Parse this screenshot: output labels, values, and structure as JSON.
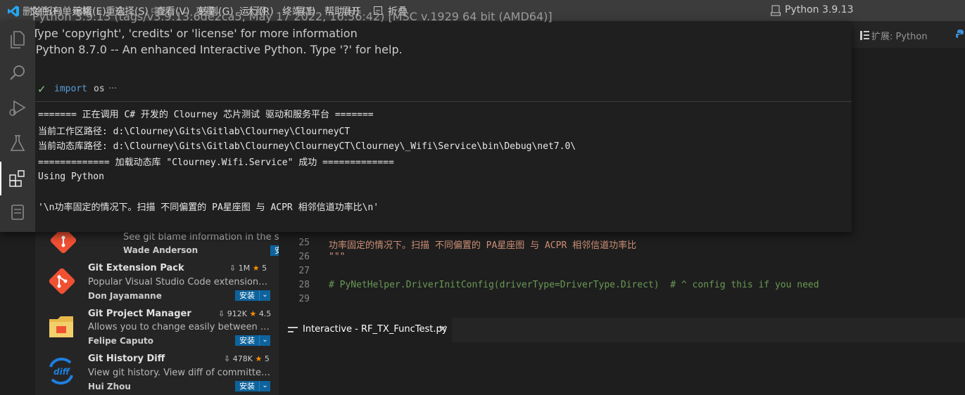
{
  "menu": {
    "items": [
      "删除所有单元格",
      "文件(F)",
      "编辑(E)",
      "重启",
      "选择(S)",
      "中断",
      "查看(V)",
      "转到(G)",
      "变量",
      "运行(R)",
      "大纲",
      "终端(T)",
      "导出",
      "帮助(H)",
      "展开",
      "折叠"
    ],
    "kernel_label": "Python 3.9.13"
  },
  "popup": {
    "header_line_1": "Python 3.9.13 (tags/v3.9.13:6de2ca5, May 17 2022, 16:36:42) [MSC v.1929 64 bit (AMD64)]",
    "header_line_2": "Type 'copyright', 'credits' or 'license' for more information",
    "header_line_3": "IPython 8.7.0 -- An enhanced Interactive Python. Type '?' for help.",
    "cell_keyword": "import",
    "cell_rest": "os",
    "cell_ellipsis": "···",
    "output": [
      "======= 正在调用 C# 开发的 Clourney 芯片测试 驱动和服务平台 =======",
      "当前工作区路径: d:\\Clourney\\Gits\\Gitlab\\Clourney\\ClourneyCT",
      "当前动态库路径: d:\\Clourney\\Gits\\Gitlab\\Clourney\\ClourneyCT\\Clourney\\_Wifi\\Service\\bin\\Debug\\net7.0\\",
      "============= 加载动态库 \"Clourney.Wifi.Service\" 成功 =============",
      "Using Python",
      "",
      "'\\n功率固定的情况下。扫描 不同偏置的 PA星座图 与 ACPR 相邻信道功率比\\n'"
    ]
  },
  "right_tab": {
    "label": "扩展: Python"
  },
  "extensions": [
    {
      "name": "",
      "desc": "See git blame information in the status bar.",
      "author": "Wade Anderson",
      "downloads": "",
      "rating": "",
      "install": "安装",
      "icon": "git-icon"
    },
    {
      "name": "Git Extension Pack",
      "desc": "Popular Visual Studio Code extensions for...",
      "author": "Don Jayamanne",
      "downloads": "1M",
      "rating": "5",
      "install": "安装",
      "icon": "git-icon"
    },
    {
      "name": "Git Project Manager",
      "desc": "Allows you to change easily between git ...",
      "author": "Felipe Caputo",
      "downloads": "912K",
      "rating": "4.5",
      "install": "安装",
      "icon": "folder-icon"
    },
    {
      "name": "Git History Diff",
      "desc": "View git history. View diff of committed fil...",
      "author": "Hui Zhou",
      "downloads": "478K",
      "rating": "5",
      "install": "安装",
      "icon": "diff-icon"
    }
  ],
  "editor": {
    "lines": [
      {
        "num": "25",
        "text": "功率固定的情况下。扫描 不同偏置的 PA星座图 与 ACPR 相邻信道功率比",
        "color": "#ce9178"
      },
      {
        "num": "26",
        "text": "\"\"\"",
        "color": "#ce9178"
      },
      {
        "num": "27",
        "text": "",
        "color": "#d4d4d4"
      },
      {
        "num": "28",
        "text": "# PyNetHelper.DriverInitConfig(driverType=DriverType.Direct)  # ^ config this if you need",
        "color": "#6a9955"
      },
      {
        "num": "29",
        "text": "",
        "color": "#d4d4d4"
      }
    ]
  },
  "interactive_tab": {
    "label": "Interactive - RF_TX_FuncTest.py"
  },
  "colors": {
    "accent": "#0e639c",
    "keyword": "#569cd6",
    "string": "#ce9178",
    "comment": "#6a9955",
    "success": "#89d185"
  }
}
